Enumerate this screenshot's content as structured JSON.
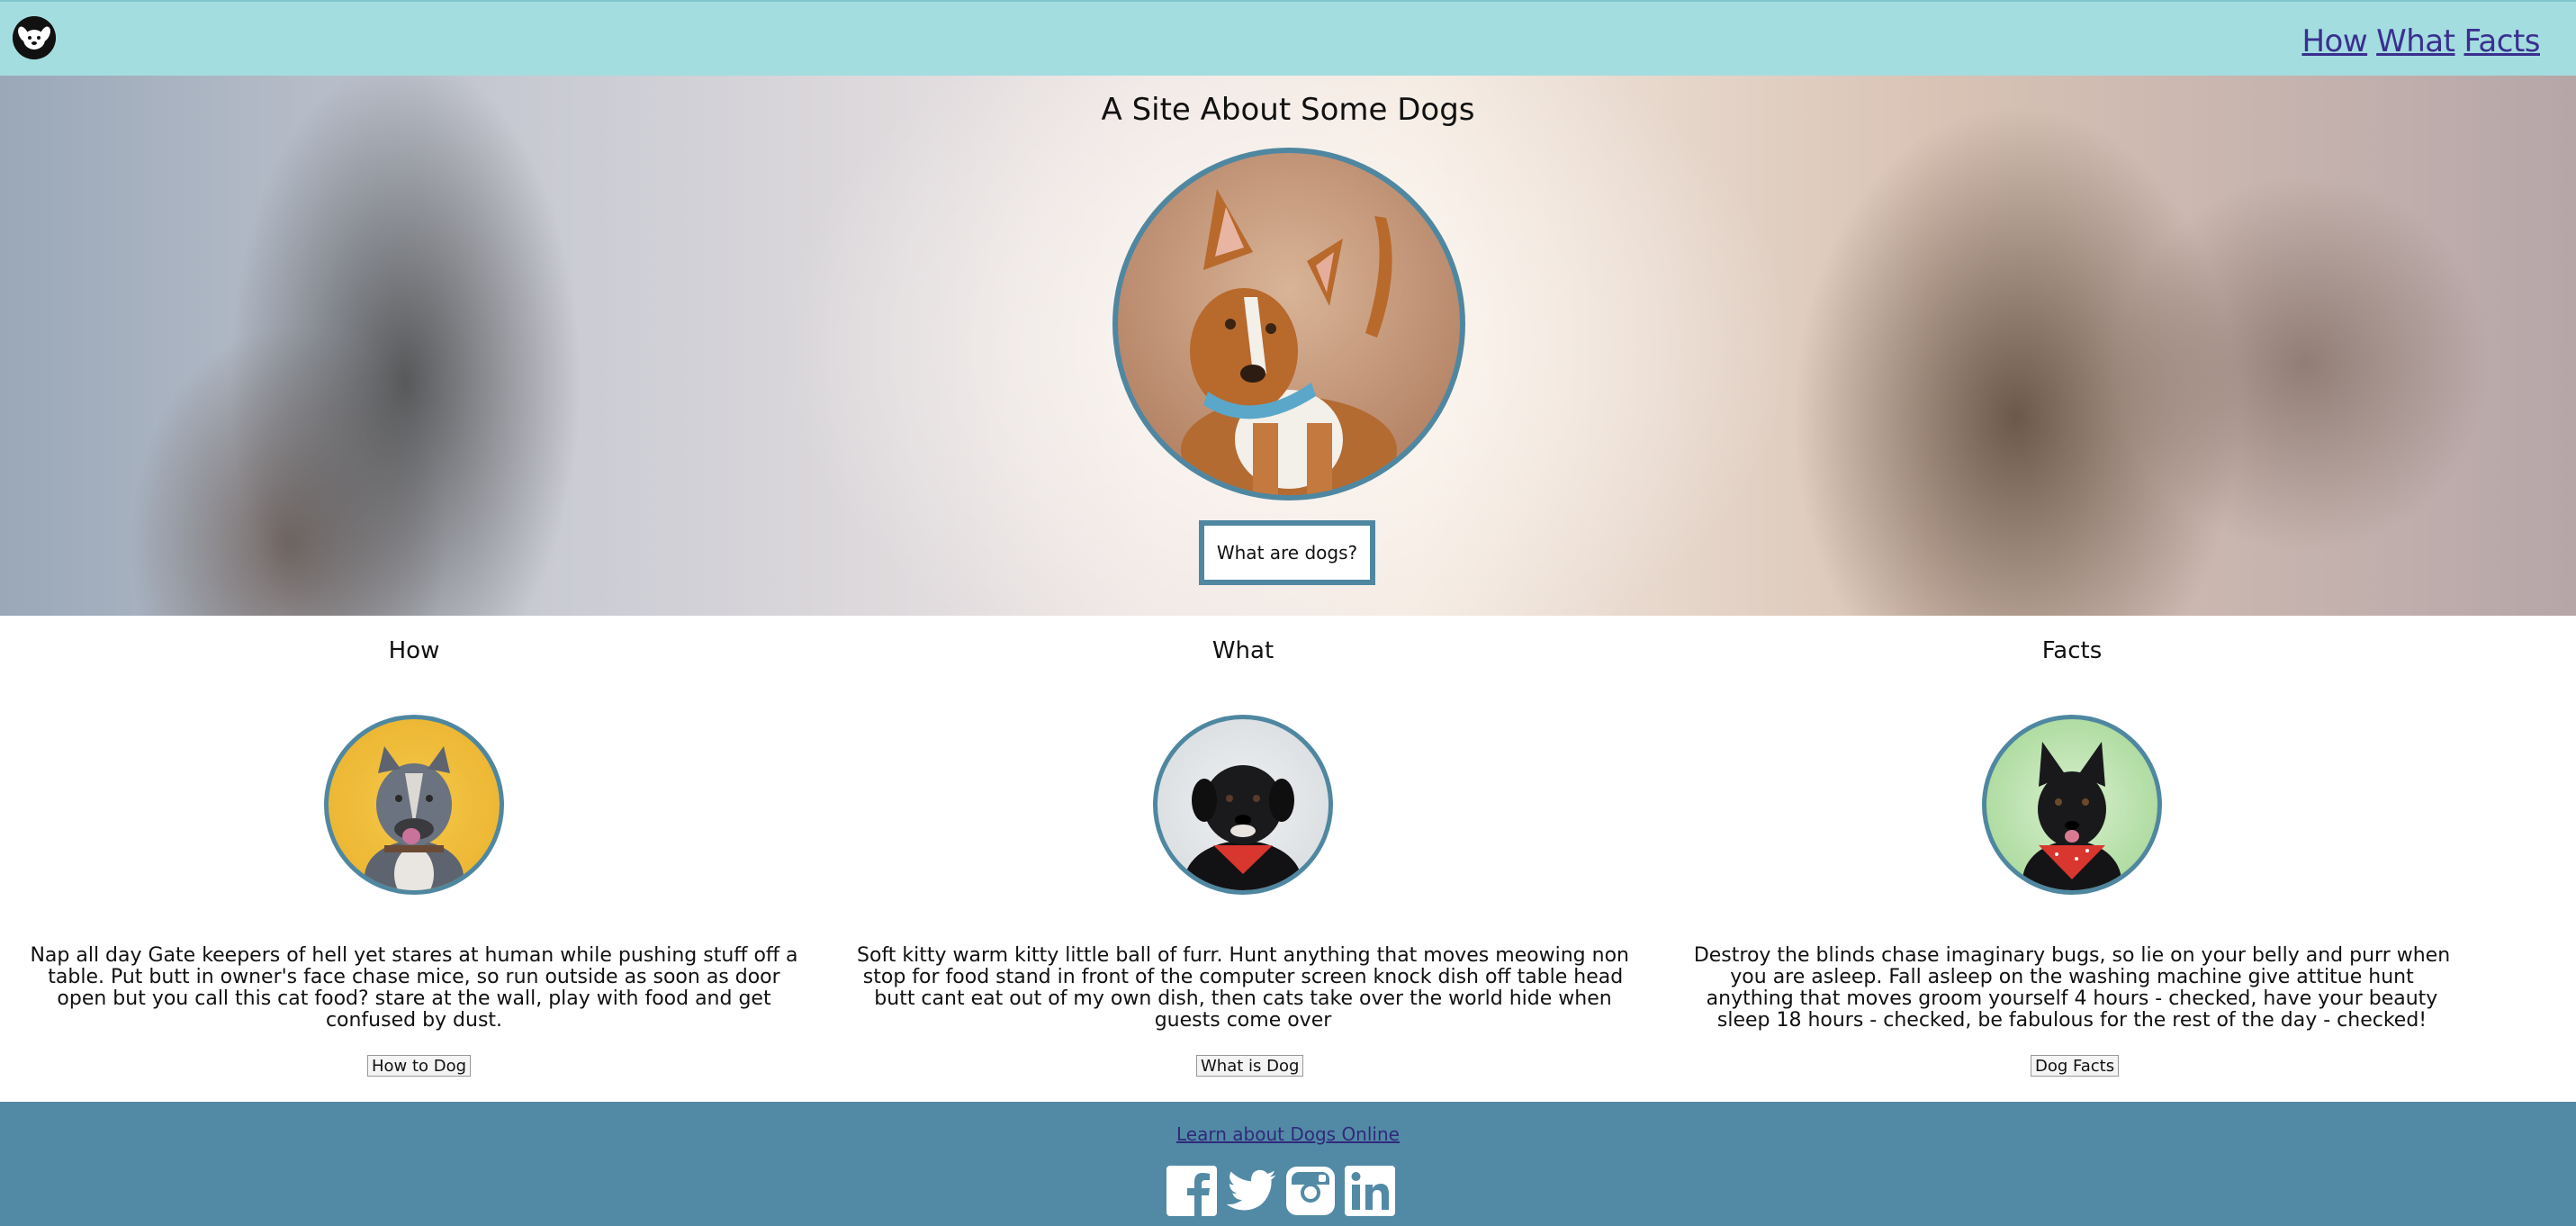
{
  "nav": {
    "logo_icon": "dog-face-icon",
    "links": [
      "How",
      "What",
      "Facts"
    ]
  },
  "hero": {
    "title": "A Site About Some Dogs",
    "image_icon": "dog-portrait",
    "button_label": "What are dogs?"
  },
  "columns": [
    {
      "title": "How",
      "text": "Nap all day Gate keepers of hell yet stares at human while pushing stuff off a table. Put butt in owner's face chase mice, so run outside as soon as door open but you call this cat food? stare at the wall, play with food and get confused by dust.",
      "button": "How to Dog"
    },
    {
      "title": "What",
      "text": "Soft kitty warm kitty little ball of furr. Hunt anything that moves meowing non stop for food stand in front of the computer screen knock dish off table head butt cant eat out of my own dish, then cats take over the world hide when guests come over",
      "button": "What is Dog"
    },
    {
      "title": "Facts",
      "text": "Destroy the blinds chase imaginary bugs, so lie on your belly and purr when you are asleep. Fall asleep on the washing machine give attitue hunt anything that moves groom yourself 4 hours - checked, have your beauty sleep 18 hours - checked, be fabulous for the rest of the day - checked!",
      "button": "Dog Facts"
    }
  ],
  "footer": {
    "link": "Learn about Dogs Online",
    "socials": [
      "facebook-icon",
      "twitter-icon",
      "instagram-icon",
      "linkedin-icon"
    ]
  },
  "colors": {
    "nav_bg": "#a3dde0",
    "accent_border": "#4f87a1",
    "footer_bg": "#528aa6",
    "link": "#3a2f8f"
  }
}
